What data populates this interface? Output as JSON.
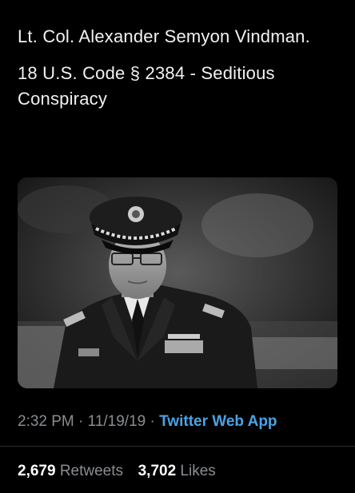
{
  "tweet": {
    "line1": "Lt. Col. Alexander Semyon Vindman.",
    "line2": "18 U.S. Code § 2384 - Seditious Conspiracy"
  },
  "meta": {
    "time": "2:32 PM",
    "sep1": "·",
    "date": "11/19/19",
    "sep2": "·",
    "app": "Twitter Web App"
  },
  "stats": {
    "retweets_count": "2,679",
    "retweets_label": "Retweets",
    "likes_count": "3,702",
    "likes_label": "Likes"
  },
  "colors": {
    "background": "#000000",
    "link": "#4aa3e6",
    "muted": "#8a8d91"
  }
}
